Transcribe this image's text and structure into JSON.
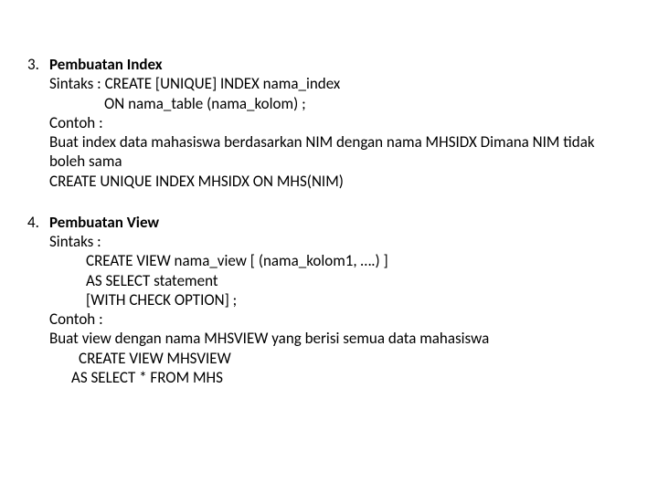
{
  "section3": {
    "number": "3.",
    "title": "Pembuatan Index",
    "line1": "Sintaks : CREATE [UNIQUE] INDEX  nama_index",
    "line2": "ON nama_table (nama_kolom) ;",
    "line3": "Contoh :",
    "line4": "Buat index data mahasiswa berdasarkan NIM dengan nama MHSIDX Dimana NIM tidak boleh sama",
    "line5": "CREATE UNIQUE  INDEX MHSIDX ON MHS(NIM)"
  },
  "section4": {
    "number": "4.",
    "title": "Pembuatan View",
    "line1": "Sintaks :",
    "line2": "CREATE VIEW nama_view [ (nama_kolom1, ….) ]",
    "line3": "AS SELECT statement",
    "line4": "[WITH CHECK OPTION] ;",
    "line5": "Contoh :",
    "line6": "Buat view dengan nama MHSVIEW yang berisi semua data mahasiswa",
    "line7": "CREATE VIEW MHSVIEW",
    "line8": "AS SELECT * FROM MHS"
  }
}
